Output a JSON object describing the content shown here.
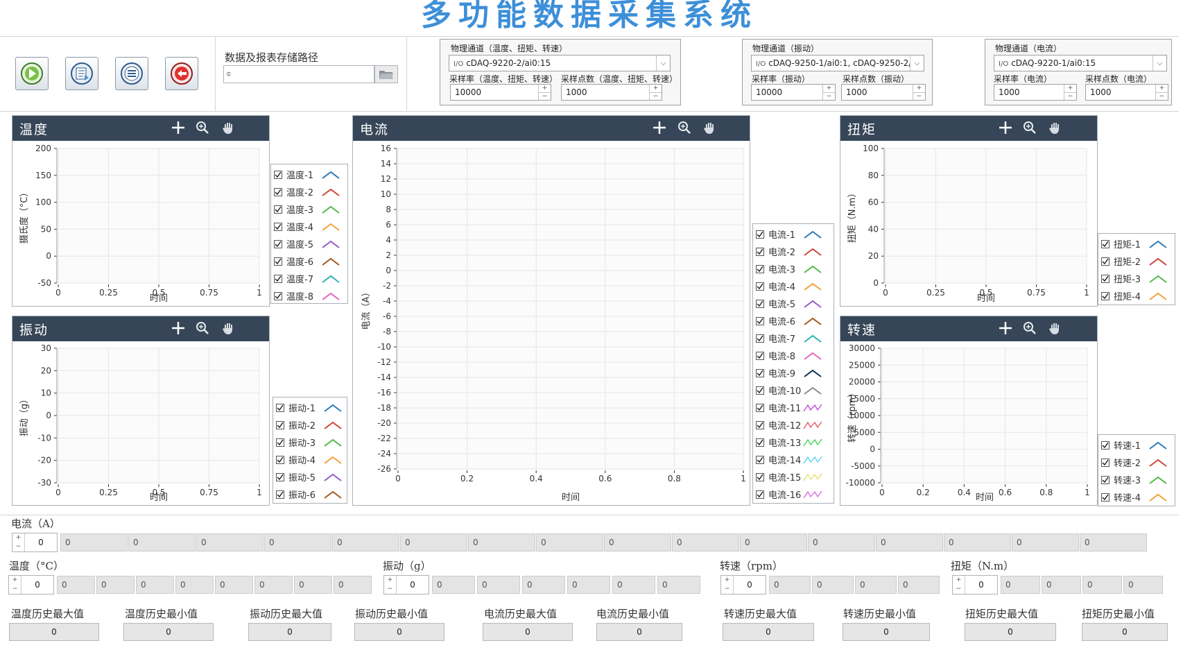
{
  "app": {
    "title": "多功能数据采集系统"
  },
  "toolbar": {
    "buttons": [
      "run",
      "report",
      "list",
      "stop"
    ]
  },
  "storage": {
    "label": "数据及报表存储路径",
    "value": ""
  },
  "channels": {
    "temp": {
      "title": "物理通道（温度、扭矩、转速）",
      "value": "cDAQ-9220-2/ai0:15",
      "rate_label": "采样率（温度、扭矩、转速）",
      "rate_value": "10000",
      "points_label": "采样点数（温度、扭矩、转速）",
      "points_value": "1000"
    },
    "vib": {
      "title": "物理通道（振动）",
      "value": "cDAQ-9250-1/ai0:1, cDAQ-9250-2/",
      "rate_label": "采样率（振动）",
      "rate_value": "10000",
      "points_label": "采样点数（振动）",
      "points_value": "1000"
    },
    "cur": {
      "title": "物理通道（电流）",
      "value": "cDAQ-9220-1/ai0:15",
      "rate_label": "采样率（电流）",
      "rate_value": "1000",
      "points_label": "采样点数（电流）",
      "points_value": "1000"
    }
  },
  "colors": {
    "header": "#364658",
    "title": "#3d8fd8",
    "series": [
      "#2a7ab8",
      "#d0433b",
      "#52b847",
      "#f3a03a",
      "#8f5cc2",
      "#a0591c",
      "#27b3b3",
      "#e364c2",
      "#0c2c54",
      "#8a8a8a",
      "#c53de0",
      "#e8505b",
      "#3ad14e",
      "#4fd0f0",
      "#e8e06a",
      "#d466e0"
    ]
  },
  "charts": [
    {
      "id": "temp",
      "title": "温度",
      "xlabel": "时间",
      "ylabel": "摄氏度（°C）",
      "xticks": [
        "0",
        "0.25",
        "0.5",
        "0.75",
        "1"
      ],
      "yticks": [
        "200",
        "150",
        "100",
        "50",
        "0",
        "-50"
      ],
      "legend": [
        "温度-1",
        "温度-2",
        "温度-3",
        "温度-4",
        "温度-5",
        "温度-6",
        "温度-7",
        "温度-8"
      ]
    },
    {
      "id": "vib",
      "title": "振动",
      "xlabel": "时间",
      "ylabel": "振动（g）",
      "xticks": [
        "0",
        "0.25",
        "0.5",
        "0.75",
        "1"
      ],
      "yticks": [
        "30",
        "20",
        "10",
        "0",
        "-10",
        "-20",
        "-30"
      ],
      "legend": [
        "振动-1",
        "振动-2",
        "振动-3",
        "振动-4",
        "振动-5",
        "振动-6"
      ]
    },
    {
      "id": "cur",
      "title": "电流",
      "xlabel": "时间",
      "ylabel": "电流（A）",
      "xticks": [
        "0",
        "0.2",
        "0.4",
        "0.6",
        "0.8",
        "1"
      ],
      "yticks": [
        "16",
        "14",
        "12",
        "10",
        "8",
        "6",
        "4",
        "2",
        "0",
        "-2",
        "-4",
        "-6",
        "-8",
        "-10",
        "-12",
        "-14",
        "-16",
        "-18",
        "-20",
        "-22",
        "-24",
        "-26"
      ],
      "legend": [
        "电流-1",
        "电流-2",
        "电流-3",
        "电流-4",
        "电流-5",
        "电流-6",
        "电流-7",
        "电流-8",
        "电流-9",
        "电流-10",
        "电流-11",
        "电流-12",
        "电流-13",
        "电流-14",
        "电流-15",
        "电流-16"
      ]
    },
    {
      "id": "torque",
      "title": "扭矩",
      "xlabel": "时间",
      "ylabel": "扭矩（N.m）",
      "xticks": [
        "0",
        "0.25",
        "0.5",
        "0.75",
        "1"
      ],
      "yticks": [
        "100",
        "80",
        "60",
        "40",
        "20",
        "0"
      ],
      "legend": [
        "扭矩-1",
        "扭矩-2",
        "扭矩-3",
        "扭矩-4"
      ]
    },
    {
      "id": "speed",
      "title": "转速",
      "xlabel": "时间",
      "ylabel": "转速（rpm）",
      "xticks": [
        "0",
        "0.2",
        "0.4",
        "0.6",
        "0.8",
        "1"
      ],
      "yticks": [
        "30000",
        "25000",
        "20000",
        "15000",
        "10000",
        "5000",
        "0",
        "-5000",
        "-10000"
      ],
      "legend": [
        "转速-1",
        "转速-2",
        "转速-3",
        "转速-4"
      ]
    }
  ],
  "arrays": {
    "current": {
      "label": "电流（A）",
      "index": "0",
      "values": [
        "0",
        "0",
        "0",
        "0",
        "0",
        "0",
        "0",
        "0",
        "0",
        "0",
        "0",
        "0",
        "0",
        "0",
        "0",
        "0"
      ]
    },
    "temp": {
      "label": "温度（°C）",
      "index": "0",
      "values": [
        "0",
        "0",
        "0",
        "0",
        "0",
        "0",
        "0",
        "0"
      ]
    },
    "vib": {
      "label": "振动（g）",
      "index": "0",
      "values": [
        "0",
        "0",
        "0",
        "0",
        "0",
        "0"
      ]
    },
    "speed": {
      "label": "转速（rpm）",
      "index": "0",
      "values": [
        "0",
        "0",
        "0",
        "0"
      ]
    },
    "torque": {
      "label": "扭矩（N.m）",
      "index": "0",
      "values": [
        "0",
        "0",
        "0",
        "0"
      ]
    }
  },
  "history": [
    {
      "label": "温度历史最大值",
      "value": "0"
    },
    {
      "label": "温度历史最小值",
      "value": "0"
    },
    {
      "label": "振动历史最大值",
      "value": "0"
    },
    {
      "label": "振动历史最小值",
      "value": "0"
    },
    {
      "label": "电流历史最大值",
      "value": "0"
    },
    {
      "label": "电流历史最小值",
      "value": "0"
    },
    {
      "label": "转速历史最大值",
      "value": "0"
    },
    {
      "label": "转速历史最小值",
      "value": "0"
    },
    {
      "label": "扭矩历史最大值",
      "value": "0"
    },
    {
      "label": "扭矩历史最小值",
      "value": "0"
    }
  ]
}
